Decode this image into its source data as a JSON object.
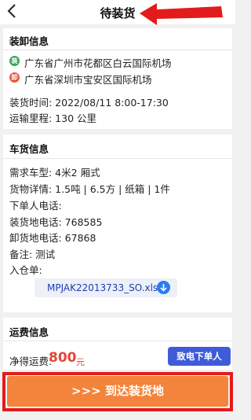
{
  "header": {
    "title": "待装货"
  },
  "loading": {
    "section_title": "装卸信息",
    "pickup_badge": "装",
    "pickup_address": "广东省广州市花都区白云国际机场",
    "drop_badge": "卸",
    "drop_address": "广东省深圳市宝安区国际机场",
    "time_line": "装货时间: 2022/08/11 8:00-17:30",
    "distance_line": "运输里程: 130 公里"
  },
  "cargo": {
    "section_title": "车货信息",
    "vehicle_line": "需求车型: 4米2 厢式",
    "details_line": "货物详情: 1.5吨 | 6.5方 | 纸箱 | 1件",
    "orderer_line": "下单人电话:",
    "load_phone_line": "装货地电话: 768585",
    "unload_phone_line": "卸货地电话: 67868",
    "remark_line": "备注: 测试",
    "warehouse_line": "入仓单:",
    "file_name": "MPJAK22013733_SO.xls"
  },
  "fee": {
    "section_title": "运费信息",
    "label": "净得运费:",
    "amount": "800",
    "unit": "元",
    "call_button": "致电下单人"
  },
  "cta": {
    "label": ">>> 到达装货地"
  },
  "colors": {
    "accent_blue": "#3e5bd8",
    "fee_red": "#e2453a",
    "cta_orange": "#f4843b",
    "pickup_green": "#3aa65a",
    "drop_red": "#e65a3c",
    "annotation_red": "#e21b1b"
  },
  "icons": {
    "back": "chevron-left-icon",
    "download": "download-arrow-icon"
  }
}
